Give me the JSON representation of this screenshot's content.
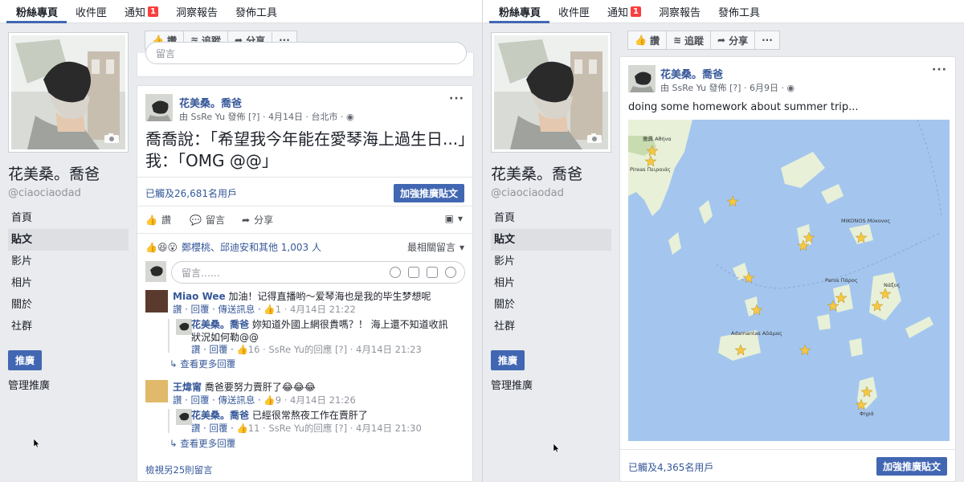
{
  "tabs": [
    {
      "label": "粉絲專頁"
    },
    {
      "label": "收件匣"
    },
    {
      "label": "通知",
      "badge": "1"
    },
    {
      "label": "洞察報告"
    },
    {
      "label": "發佈工具"
    }
  ],
  "profile": {
    "name": "花美桑。喬爸",
    "handle": "@ciaociaodad",
    "nav": [
      "首頁",
      "貼文",
      "影片",
      "相片",
      "關於",
      "社群"
    ],
    "promote": "推廣",
    "manage": "管理推廣"
  },
  "actions": {
    "like": "讚",
    "follow": "追蹤",
    "share": "分享",
    "more": "···"
  },
  "left_post": {
    "author": "花美桑。喬爸",
    "meta": "由 SsRe Yu 發佈 [?] · 4月14日 · 台北市 · ",
    "text": "喬喬說：「希望我今年能在愛琴海上過生日...」我：「OMG @@」",
    "reach": "已觸及26,681名用戶",
    "boost": "加強推廣貼文",
    "like": "讚",
    "comment": "留言",
    "share": "分享",
    "reactions": "鄭櫻桃、邱迪安和其他 1,003 人",
    "sort": "最相關留言",
    "comment_placeholder": "留言……",
    "view_more": "檢視另25則留言",
    "comments": [
      {
        "name": "Miao Wee",
        "text": "加油！记得直播哟～爱琴海也是我的毕生梦想呢",
        "meta": "讚 · 回覆 · 傳送訊息 · ",
        "count": "1",
        "time": " · 4月14日 21:22"
      },
      {
        "name": "花美桑。喬爸",
        "text": "妳知道外國上網很貴嗎？！ 海上還不知道收訊狀況如何勒@@",
        "meta": "讚 · 回覆 · ",
        "count": "16",
        "by": " · SsRe Yu的回應 [?] · 4月14日 21:23"
      },
      {
        "more_replies": "查看更多回覆"
      },
      {
        "name": "王煒甯",
        "text": "喬爸要努力賣肝了😂😂😂",
        "meta": "讚 · 回覆 · 傳送訊息 · ",
        "count": "9",
        "time": " · 4月14日 21:26"
      },
      {
        "name": "花美桑。喬爸",
        "text": "已經很常熬夜工作在賣肝了",
        "meta": "讚 · 回覆 · ",
        "count": "11",
        "by": " · SsRe Yu的回應 [?] · 4月14日 21:30"
      },
      {
        "more_replies": "查看更多回覆"
      }
    ],
    "top_comment_placeholder": "留言"
  },
  "right_post": {
    "author": "花美桑。喬爸",
    "meta": "由 SsRe Yu 發佈 [?] · 6月9日 · ",
    "text": "doing some homework about summer trip...",
    "reach": "已觸及4,365名用戶",
    "boost": "加強推廣貼文",
    "map_labels": {
      "athens": "雅典 Αθήνα",
      "piraeus": "Pireas Πειραιάς",
      "mykonos": "MIKONOS Μύκονος",
      "paros": "Paros Πάρος",
      "naxos": "Νάξος",
      "adamantas": "Adamantas Αδάμας",
      "fira": "Φηρά"
    }
  }
}
